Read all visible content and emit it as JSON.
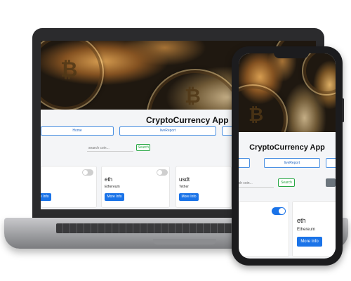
{
  "app": {
    "title": "CryptoCurrency App",
    "nav": [
      "Home",
      "liveReport"
    ],
    "search": {
      "placeholder": "search coin...",
      "button_label": "Search"
    }
  },
  "coins": [
    {
      "symbol": "eth",
      "name": "Ethereum",
      "button_label": "More Info"
    },
    {
      "symbol": "usdt",
      "name": "Tether",
      "button_label": "More Info"
    }
  ],
  "first_card_button_label": "More Info",
  "colors": {
    "primary_button": "#1a73e8",
    "search_button": "#28a745",
    "nav_border": "#4a90e2",
    "toggle_on": "#1a73e8",
    "toggle_off": "#cfcfcf"
  }
}
